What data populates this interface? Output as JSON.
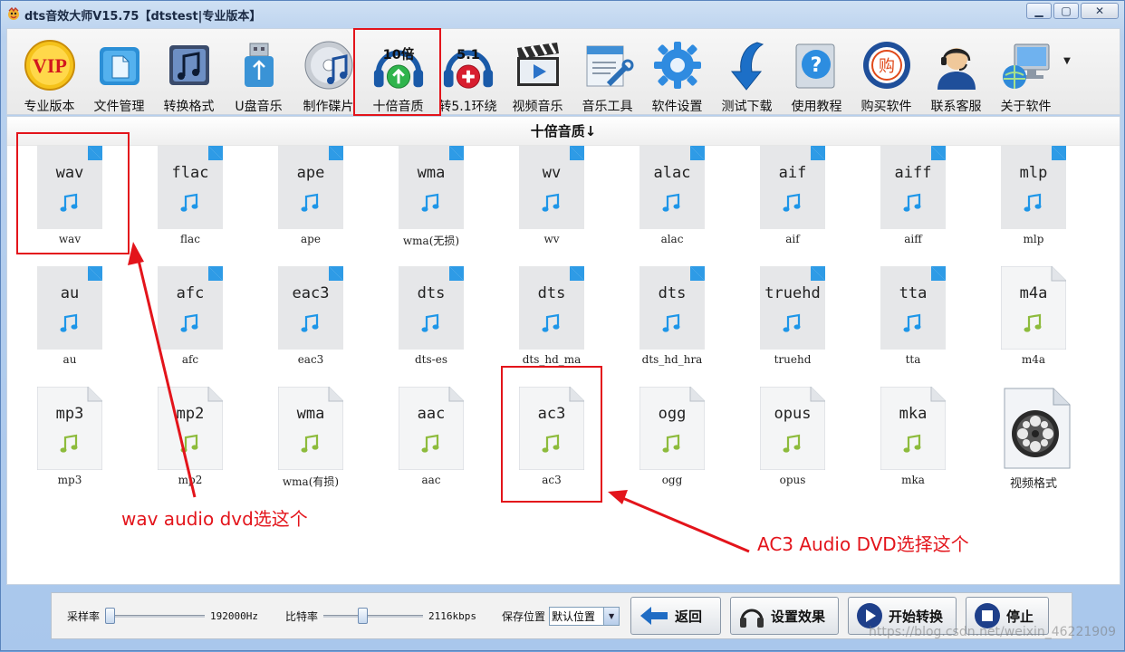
{
  "window": {
    "title": "dts音效大师V15.75【dtstest|专业版本】",
    "controls": [
      "minimize-icon",
      "maximize-icon",
      "close-icon"
    ]
  },
  "toolbar": {
    "items": [
      {
        "label": "专业版本",
        "icon": "vip-icon",
        "badge": "VIP"
      },
      {
        "label": "文件管理",
        "icon": "folder-icon"
      },
      {
        "label": "转换格式",
        "icon": "music-convert-icon"
      },
      {
        "label": "U盘音乐",
        "icon": "usb-icon"
      },
      {
        "label": "制作碟片",
        "icon": "disc-icon"
      },
      {
        "label": "十倍音质",
        "icon": "headphone-10x-icon",
        "badge": "10倍"
      },
      {
        "label": "转5.1环绕",
        "icon": "headphone-51-icon",
        "badge": "5.1"
      },
      {
        "label": "视频音乐",
        "icon": "clapper-icon"
      },
      {
        "label": "音乐工具",
        "icon": "tools-icon"
      },
      {
        "label": "软件设置",
        "icon": "gear-icon"
      },
      {
        "label": "测试下载",
        "icon": "download-arrow-icon"
      },
      {
        "label": "使用教程",
        "icon": "help-icon"
      },
      {
        "label": "购买软件",
        "icon": "buy-icon",
        "badge": "购"
      },
      {
        "label": "联系客服",
        "icon": "support-agent-icon"
      },
      {
        "label": "关于软件",
        "icon": "computer-globe-icon"
      }
    ]
  },
  "content": {
    "header": "十倍音质↓",
    "formats": [
      {
        "ext": "wav",
        "name": "wav",
        "style": "blue"
      },
      {
        "ext": "flac",
        "name": "flac",
        "style": "blue"
      },
      {
        "ext": "ape",
        "name": "ape",
        "style": "blue"
      },
      {
        "ext": "wma",
        "name": "wma(无损)",
        "style": "blue"
      },
      {
        "ext": "wv",
        "name": "wv",
        "style": "blue"
      },
      {
        "ext": "alac",
        "name": "alac",
        "style": "blue"
      },
      {
        "ext": "aif",
        "name": "aif",
        "style": "blue"
      },
      {
        "ext": "aiff",
        "name": "aiff",
        "style": "blue"
      },
      {
        "ext": "mlp",
        "name": "mlp",
        "style": "blue"
      },
      {
        "ext": "au",
        "name": "au",
        "style": "blue"
      },
      {
        "ext": "afc",
        "name": "afc",
        "style": "blue"
      },
      {
        "ext": "eac3",
        "name": "eac3",
        "style": "blue"
      },
      {
        "ext": "dts",
        "name": "dts-es",
        "style": "blue"
      },
      {
        "ext": "dts",
        "name": "dts_hd_ma",
        "style": "blue"
      },
      {
        "ext": "dts",
        "name": "dts_hd_hra",
        "style": "blue"
      },
      {
        "ext": "truehd",
        "name": "truehd",
        "style": "blue"
      },
      {
        "ext": "tta",
        "name": "tta",
        "style": "blue"
      },
      {
        "ext": "m4a",
        "name": "m4a",
        "style": "green"
      },
      {
        "ext": "mp3",
        "name": "mp3",
        "style": "green"
      },
      {
        "ext": "mp2",
        "name": "mp2",
        "style": "green"
      },
      {
        "ext": "wma",
        "name": "wma(有损)",
        "style": "green"
      },
      {
        "ext": "aac",
        "name": "aac",
        "style": "green"
      },
      {
        "ext": "ac3",
        "name": "ac3",
        "style": "green"
      },
      {
        "ext": "ogg",
        "name": "ogg",
        "style": "green"
      },
      {
        "ext": "opus",
        "name": "opus",
        "style": "green"
      },
      {
        "ext": "mka",
        "name": "mka",
        "style": "green"
      },
      {
        "ext": "",
        "name": "视频格式",
        "style": "video"
      }
    ]
  },
  "annotations": {
    "wav_note": "wav audio dvd选这个",
    "ac3_note": "AC3 Audio DVD选择这个",
    "color": "#e3141b"
  },
  "bottom": {
    "sample_rate_label": "采样率",
    "sample_rate_value": "192000Hz",
    "sample_rate_level": 0.0,
    "bitrate_label": "比特率",
    "bitrate_value": "2116kbps",
    "bitrate_level": 0.38,
    "save_label": "保存位置",
    "save_value": "默认位置",
    "buttons": {
      "back": "返回",
      "effect": "设置效果",
      "start": "开始转换",
      "stop": "停止"
    }
  },
  "watermark": "https://blog.csdn.net/weixin_46221909"
}
